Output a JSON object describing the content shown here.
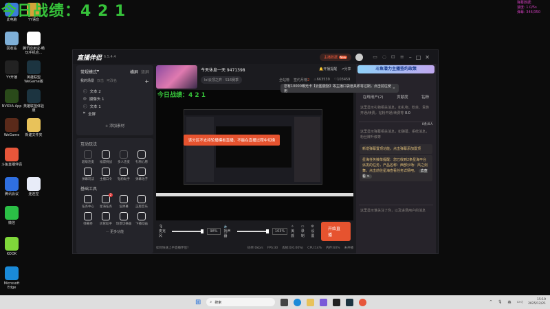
{
  "overlay": {
    "score": "今日战绩：4 2 1",
    "stats": [
      "弹幕数据:",
      "速度: 1.0/5s",
      "弹幕: 346/350"
    ]
  },
  "desktop": [
    {
      "label": "此电脑",
      "color": "#3b7bd8"
    },
    {
      "label": "YY语音",
      "color": "#d4a33a"
    },
    {
      "label": "回收站",
      "color": "#7fb0d8"
    },
    {
      "label": "腾讯应用宝-畅玩手机应...",
      "color": "#ffffff"
    },
    {
      "label": "YY开播",
      "color": "#222222"
    },
    {
      "label": "英雄联盟WeGame版",
      "color": "#1c3440"
    },
    {
      "label": "NVIDIA App",
      "color": "#2a4a1a"
    },
    {
      "label": "英雄联盟体验服",
      "color": "#1c3440"
    },
    {
      "label": "WeGame",
      "color": "#5a2a1a"
    },
    {
      "label": "新建文件夹",
      "color": "#e8c25a"
    },
    {
      "label": "斗鱼直播伴侣",
      "color": "#e7563a"
    },
    {
      "label": "腾讯会议",
      "color": "#2f6fe0"
    },
    {
      "label": "连连控",
      "color": "#e8ecf8"
    },
    {
      "label": "微信",
      "color": "#2bc046"
    },
    {
      "label": "KOOK",
      "color": "#7fd83a"
    },
    {
      "label": "Microsoft Edge",
      "color": "#1a8ad8"
    }
  ],
  "app": {
    "title": "直播伴侣",
    "version": "6.5.4.4",
    "host_data": "主播数据",
    "new_badge": "New",
    "room": {
      "title": "今天休息一天 9471398",
      "category": "lol云顶之弈 · S16赛季",
      "remind": "开播提醒",
      "share": "分享",
      "fans": "全站榜",
      "sign": "签约月榜",
      "sign_num": "2",
      "hot": "663539",
      "likes": "103459"
    },
    "banner": "斗鱼潜力主播签约政策",
    "tip": "您有10000曝光卡【云图激励】等主播口袋道具即将过期，点击前往使用",
    "mode": "常规模式",
    "landscape": "横屏",
    "portrait": "竖屏",
    "scenes_label": "我的场景",
    "scene_tabs": [
      "双击",
      "可改名"
    ],
    "sources": [
      {
        "icon": "text",
        "label": "文本 2"
      },
      {
        "icon": "camera",
        "label": "摄像头 1"
      },
      {
        "icon": "text",
        "label": "文本 1"
      },
      {
        "icon": "fullscreen",
        "label": "全屏"
      }
    ],
    "add_source": "+ 添加素材",
    "interactive_title": "互动玩法",
    "interactive": [
      "超级连麦",
      "福盟挑战",
      "多人连麦",
      "礼物心愿",
      "弹幕玩法",
      "主播口令",
      "钻粉助手",
      "弹幕池子"
    ],
    "tools_title": "基础工具",
    "tools": [
      "任务中心",
      "星海任务",
      "设弹幕",
      "正版音乐",
      "弹幕秀",
      "房管助手",
      "场景切换器",
      "下播动画"
    ],
    "tools_badge": "2",
    "more": "··· 更多功能",
    "preview_score": "今日战绩：4 2 1",
    "toast": "该分区不支持轮播模板直播，不能在直播过程中切换",
    "controls": {
      "mic": "麦克风",
      "mic_pct": "98%",
      "speaker": "扬声器",
      "speaker_pct": "103%",
      "beauty": "美颜",
      "record": "录制",
      "settings": "设置",
      "start": "开始直播"
    },
    "status": {
      "help": "如何快速上手直播伴侣?",
      "bitrate": "码率:0kb/s",
      "fps": "FPS:30",
      "drop": "丢帧:0(0.00%)",
      "cpu": "CPU:14%",
      "mem": "内存:60%",
      "live": "未开播"
    },
    "right": {
      "tabs": [
        "在线用户(2)",
        "贡献度",
        "钻粉"
      ],
      "gift_msg": "这里显示礼物相关消息，如礼物、粉丝、贵族开通/续费，钻粉开通/续费等",
      "gift_val": "0.0",
      "chat_msg": "这里显示弹幕相关消息，如弹幕、系统消息，粉丝牌升级等",
      "chat_count": "0条/0人",
      "notice1": "新增弹幕置顶功能，点击弹幕添加置顶",
      "notice2": "星海任务接单提醒：您已收到2条星海平台派发的任务，产品名称：西部沙场：风之剑舞。点击前往星海查看任务详情吧。",
      "goto": "去查看 >",
      "follow_msg": "这里显示谁关注了你，以及进场用户的消息"
    }
  },
  "taskbar": {
    "search": "搜索",
    "lang": "英",
    "time": "15:19",
    "date": "2025/12/21"
  }
}
